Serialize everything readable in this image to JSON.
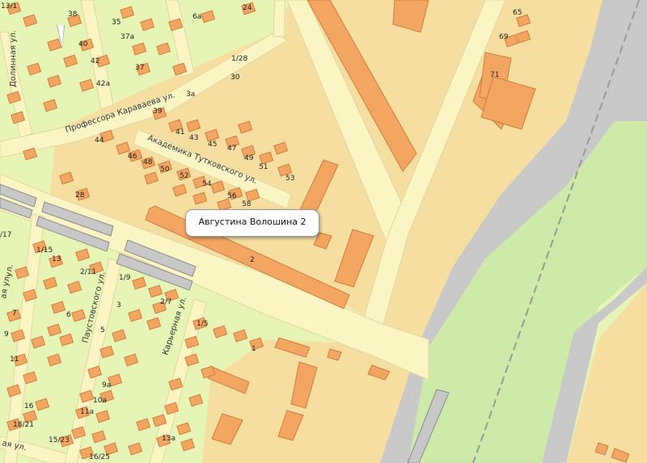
{
  "colors": {
    "residential": "#e6f5b5",
    "industrial": "#f5dea0",
    "road": "#fbf5c4",
    "road_edge": "#e1d6a5",
    "building": "#f2a662",
    "building_edge": "#cf7d3a",
    "park": "#cdeaa9",
    "rail_bg": "#c9c9c9",
    "rail": "#9a9a9a"
  },
  "streets": {
    "dolinnaya": "Долинная ул.",
    "karavaeva": "Профессора Караваева ул.",
    "tutkovskogo": "Академика Тутковского ул.",
    "paustovskogo": "Паустовского ул.",
    "karernaya": "Карьерная ул.",
    "bottom_left_fragment": "ая ул.",
    "left_fragment_1": "ул.",
    "left_fragment_2": "ая ул."
  },
  "house_numbers": [
    "13/1",
    "38",
    "35",
    "6а",
    "24",
    "40",
    "37а",
    "37",
    "42",
    "42а",
    "1/28",
    "30",
    "3а",
    "39",
    "41",
    "43",
    "45",
    "47",
    "49",
    "51",
    "53",
    "44",
    "46",
    "48",
    "50",
    "52",
    "54",
    "56",
    "58",
    "28",
    "2",
    "/17",
    "1/15",
    "13",
    "2/11",
    "1/9",
    "3",
    "2/7",
    "7",
    "6",
    "9",
    "5",
    "1/5",
    "1",
    "11",
    "9а",
    "10а",
    "11а",
    "16",
    "18/21",
    "15/23",
    "13а",
    "16/25",
    "65",
    "69",
    "71"
  ],
  "popup": {
    "title": "Августина Волошина 2"
  }
}
